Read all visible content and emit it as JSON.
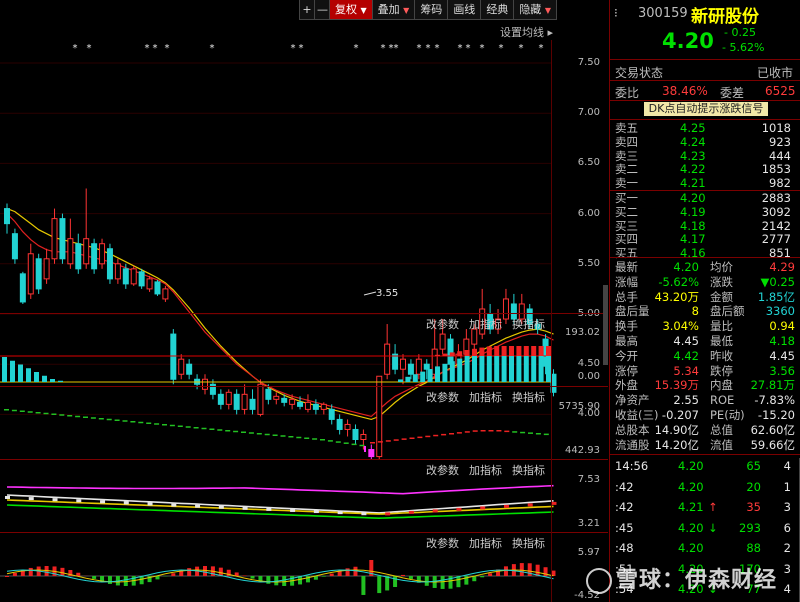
{
  "toolbar": {
    "plus": "+",
    "minus": "—",
    "fuquan": "复权",
    "diejia": "叠加",
    "chouma": "筹码",
    "huaxian": "画线",
    "jingdian": "经典",
    "tiaozhan": "隐藏",
    "dropdown_arrow": "▼"
  },
  "main_chart": {
    "setting_label": "设置均线",
    "low_marker": "3.55",
    "price_ticks": [
      "7.50",
      "7.00",
      "6.50",
      "6.00",
      "5.50",
      "5.00",
      "4.50",
      "4.00"
    ],
    "kline": [
      {
        "o": 6.05,
        "c": 5.9,
        "h": 6.1,
        "l": 5.8
      },
      {
        "o": 5.8,
        "c": 5.55,
        "h": 5.85,
        "l": 5.5
      },
      {
        "o": 5.4,
        "c": 5.12,
        "h": 5.42,
        "l": 5.1
      },
      {
        "o": 5.2,
        "c": 5.6,
        "h": 5.7,
        "l": 5.15
      },
      {
        "o": 5.55,
        "c": 5.25,
        "h": 5.6,
        "l": 5.2
      },
      {
        "o": 5.35,
        "c": 5.55,
        "h": 5.65,
        "l": 5.3
      },
      {
        "o": 5.55,
        "c": 5.95,
        "h": 6.05,
        "l": 5.5
      },
      {
        "o": 5.95,
        "c": 5.55,
        "h": 6.0,
        "l": 5.5
      },
      {
        "o": 5.5,
        "c": 5.75,
        "h": 5.95,
        "l": 5.45
      },
      {
        "o": 5.7,
        "c": 5.45,
        "h": 5.8,
        "l": 5.4
      },
      {
        "o": 5.5,
        "c": 5.75,
        "h": 6.25,
        "l": 5.45
      },
      {
        "o": 5.7,
        "c": 5.45,
        "h": 5.75,
        "l": 5.4
      },
      {
        "o": 5.5,
        "c": 5.7,
        "h": 5.75,
        "l": 5.45
      },
      {
        "o": 5.65,
        "c": 5.35,
        "h": 5.7,
        "l": 5.3
      },
      {
        "o": 5.35,
        "c": 5.5,
        "h": 5.55,
        "l": 5.3
      },
      {
        "o": 5.45,
        "c": 5.3,
        "h": 5.5,
        "l": 5.25
      },
      {
        "o": 5.3,
        "c": 5.45,
        "h": 5.48,
        "l": 5.28
      },
      {
        "o": 5.42,
        "c": 5.28,
        "h": 5.45,
        "l": 5.25
      },
      {
        "o": 5.25,
        "c": 5.35,
        "h": 5.38,
        "l": 5.22
      },
      {
        "o": 5.32,
        "c": 5.2,
        "h": 5.34,
        "l": 5.18
      },
      {
        "o": 5.15,
        "c": 5.25,
        "h": 5.28,
        "l": 5.12
      },
      {
        "o": 4.8,
        "c": 4.35,
        "h": 4.85,
        "l": 4.3
      },
      {
        "o": 4.4,
        "c": 4.55,
        "h": 4.6,
        "l": 4.35
      },
      {
        "o": 4.5,
        "c": 4.4,
        "h": 4.55,
        "l": 4.35
      },
      {
        "o": 4.35,
        "c": 4.3,
        "h": 4.4,
        "l": 4.25
      },
      {
        "o": 4.25,
        "c": 4.35,
        "h": 4.4,
        "l": 4.2
      },
      {
        "o": 4.3,
        "c": 4.2,
        "h": 4.35,
        "l": 4.15
      },
      {
        "o": 4.2,
        "c": 4.1,
        "h": 4.25,
        "l": 4.05
      },
      {
        "o": 4.1,
        "c": 4.22,
        "h": 4.25,
        "l": 4.05
      },
      {
        "o": 4.2,
        "c": 4.05,
        "h": 4.25,
        "l": 4.0
      },
      {
        "o": 4.05,
        "c": 4.2,
        "h": 4.3,
        "l": 4.0
      },
      {
        "o": 4.15,
        "c": 4.05,
        "h": 4.25,
        "l": 4.0
      },
      {
        "o": 4.0,
        "c": 4.3,
        "h": 4.35,
        "l": 3.98
      },
      {
        "o": 4.25,
        "c": 4.15,
        "h": 4.3,
        "l": 4.1
      },
      {
        "o": 4.15,
        "c": 4.18,
        "h": 4.22,
        "l": 4.1
      },
      {
        "o": 4.16,
        "c": 4.12,
        "h": 4.2,
        "l": 4.08
      },
      {
        "o": 4.1,
        "c": 4.15,
        "h": 4.2,
        "l": 4.05
      },
      {
        "o": 4.12,
        "c": 4.08,
        "h": 4.18,
        "l": 4.05
      },
      {
        "o": 4.05,
        "c": 4.12,
        "h": 4.2,
        "l": 4.02
      },
      {
        "o": 4.1,
        "c": 4.05,
        "h": 4.15,
        "l": 4.0
      },
      {
        "o": 4.05,
        "c": 4.1,
        "h": 4.12,
        "l": 4.0
      },
      {
        "o": 4.05,
        "c": 3.95,
        "h": 4.1,
        "l": 3.9
      },
      {
        "o": 3.95,
        "c": 3.85,
        "h": 4.0,
        "l": 3.8
      },
      {
        "o": 3.85,
        "c": 3.9,
        "h": 3.95,
        "l": 3.78
      },
      {
        "o": 3.85,
        "c": 3.75,
        "h": 3.9,
        "l": 3.7
      },
      {
        "o": 3.75,
        "c": 3.8,
        "h": 3.85,
        "l": 3.65
      },
      {
        "o": 3.65,
        "c": 3.58,
        "h": 3.7,
        "l": 3.55
      },
      {
        "o": 3.58,
        "c": 4.38,
        "h": 4.38,
        "l": 3.55
      },
      {
        "o": 4.4,
        "c": 4.7,
        "h": 4.9,
        "l": 4.35
      },
      {
        "o": 4.6,
        "c": 4.45,
        "h": 4.7,
        "l": 4.4
      },
      {
        "o": 4.45,
        "c": 4.55,
        "h": 4.6,
        "l": 4.3
      },
      {
        "o": 4.5,
        "c": 4.4,
        "h": 4.55,
        "l": 4.35
      },
      {
        "o": 4.4,
        "c": 4.55,
        "h": 4.6,
        "l": 4.35
      },
      {
        "o": 4.5,
        "c": 4.45,
        "h": 4.55,
        "l": 4.35
      },
      {
        "o": 4.4,
        "c": 4.65,
        "h": 4.95,
        "l": 4.35
      },
      {
        "o": 4.65,
        "c": 4.8,
        "h": 4.95,
        "l": 4.6
      },
      {
        "o": 4.75,
        "c": 4.5,
        "h": 4.8,
        "l": 4.45
      },
      {
        "o": 4.5,
        "c": 4.6,
        "h": 4.7,
        "l": 4.45
      },
      {
        "o": 4.6,
        "c": 4.75,
        "h": 4.85,
        "l": 4.55
      },
      {
        "o": 4.7,
        "c": 4.85,
        "h": 4.9,
        "l": 4.65
      },
      {
        "o": 4.8,
        "c": 5.05,
        "h": 5.25,
        "l": 4.75
      },
      {
        "o": 5.0,
        "c": 4.85,
        "h": 5.1,
        "l": 4.8
      },
      {
        "o": 4.85,
        "c": 4.95,
        "h": 5.05,
        "l": 4.8
      },
      {
        "o": 4.95,
        "c": 5.15,
        "h": 5.25,
        "l": 4.9
      },
      {
        "o": 5.1,
        "c": 4.95,
        "h": 5.2,
        "l": 4.9
      },
      {
        "o": 4.95,
        "c": 5.1,
        "h": 5.2,
        "l": 4.9
      },
      {
        "o": 5.05,
        "c": 4.9,
        "h": 5.1,
        "l": 4.85
      },
      {
        "o": 4.9,
        "c": 4.85,
        "h": 4.95,
        "l": 4.8
      },
      {
        "o": 4.75,
        "c": 4.48,
        "h": 4.8,
        "l": 4.4
      },
      {
        "o": 4.4,
        "c": 4.22,
        "h": 4.45,
        "l": 4.18
      }
    ],
    "ma_red": [
      6.0,
      5.92,
      5.82,
      5.74,
      5.68,
      5.64,
      5.62,
      5.62,
      5.62,
      5.6,
      5.58,
      5.56,
      5.54,
      5.52,
      5.49,
      5.46,
      5.43,
      5.4,
      5.37,
      5.34,
      5.3,
      5.22,
      5.12,
      5.02,
      4.92,
      4.82,
      4.74,
      4.66,
      4.58,
      4.5,
      4.44,
      4.38,
      4.32,
      4.28,
      4.24,
      4.21,
      4.18,
      4.16,
      4.14,
      4.12,
      4.1,
      4.08,
      4.06,
      4.04,
      4.02,
      4.0,
      3.98,
      4.05,
      4.12,
      4.18,
      4.22,
      4.26,
      4.3,
      4.33,
      4.38,
      4.42,
      4.45,
      4.48,
      4.51,
      4.55,
      4.6,
      4.64,
      4.68,
      4.72,
      4.75,
      4.78,
      4.8,
      4.8,
      4.78,
      4.74
    ],
    "ma_yellow": [
      6.05,
      6.02,
      5.96,
      5.9,
      5.84,
      5.8,
      5.76,
      5.74,
      5.72,
      5.7,
      5.68,
      5.66,
      5.63,
      5.6,
      5.56,
      5.52,
      5.48,
      5.44,
      5.4,
      5.36,
      5.31,
      5.24,
      5.15,
      5.06,
      4.96,
      4.86,
      4.77,
      4.68,
      4.6,
      4.52,
      4.45,
      4.38,
      4.32,
      4.27,
      4.23,
      4.19,
      4.16,
      4.13,
      4.11,
      4.09,
      4.07,
      4.05,
      4.03,
      4.01,
      3.99,
      3.97,
      3.95,
      3.98,
      4.05,
      4.12,
      4.18,
      4.23,
      4.28,
      4.32,
      4.37,
      4.42,
      4.46,
      4.5,
      4.54,
      4.59,
      4.64,
      4.68,
      4.72,
      4.76,
      4.79,
      4.82,
      4.84,
      4.85,
      4.83,
      4.8
    ]
  },
  "sub_labels": {
    "gaicanshu": "改参数",
    "jiazhibiao": "加指标",
    "huanzhibiao": "换指标",
    "sub1_max": "193.02",
    "sub1_min": "0.00",
    "sub2_max": "5735.90",
    "sub2_min": "442.93",
    "sub3_max": "7.53",
    "sub3_min": "3.21",
    "sub4_max": "5.97",
    "sub4_min": "-4.52"
  },
  "quote": {
    "code": "300159",
    "name": "新研股份",
    "price": "4.20",
    "change": "- 0.25",
    "change_pct": "- 5.62%",
    "trade_status_label": "交易状态",
    "trade_status": "已收市",
    "weibi_label": "委比",
    "weibi": "38.46%",
    "weicha_label": "委差",
    "weicha": "6525",
    "dk_signal": "DK点自动提示涨跌信号",
    "sell": [
      {
        "label": "卖五",
        "price": "4.25",
        "vol": "1018"
      },
      {
        "label": "卖四",
        "price": "4.24",
        "vol": "923"
      },
      {
        "label": "卖三",
        "price": "4.23",
        "vol": "444"
      },
      {
        "label": "卖二",
        "price": "4.22",
        "vol": "1853"
      },
      {
        "label": "卖一",
        "price": "4.21",
        "vol": "982"
      }
    ],
    "buy": [
      {
        "label": "买一",
        "price": "4.20",
        "vol": "2883"
      },
      {
        "label": "买二",
        "price": "4.19",
        "vol": "3092"
      },
      {
        "label": "买三",
        "price": "4.18",
        "vol": "2142"
      },
      {
        "label": "买四",
        "price": "4.17",
        "vol": "2777"
      },
      {
        "label": "买五",
        "price": "4.16",
        "vol": "851"
      }
    ],
    "stats": [
      {
        "l1": "最新",
        "v1": "4.20",
        "c1": "grn",
        "l2": "均价",
        "v2": "4.29",
        "c2": "red"
      },
      {
        "l1": "涨幅",
        "v1": "-5.62%",
        "c1": "grn",
        "l2": "涨跌",
        "v2": "▼0.25",
        "c2": "grn"
      },
      {
        "l1": "总手",
        "v1": "43.20万",
        "c1": "yel",
        "l2": "金额",
        "v2": "1.85亿",
        "c2": "cy"
      },
      {
        "l1": "盘后量",
        "v1": "8",
        "c1": "yel",
        "l2": "盘后额",
        "v2": "3360",
        "c2": "cy"
      },
      {
        "l1": "换手",
        "v1": "3.04%",
        "c1": "yel",
        "l2": "量比",
        "v2": "0.94",
        "c2": "yel"
      },
      {
        "l1": "最高",
        "v1": "4.45",
        "c1": "wht",
        "l2": "最低",
        "v2": "4.18",
        "c2": "grn"
      },
      {
        "l1": "今开",
        "v1": "4.42",
        "c1": "grn",
        "l2": "昨收",
        "v2": "4.45",
        "c2": "wht"
      },
      {
        "l1": "涨停",
        "v1": "5.34",
        "c1": "red",
        "l2": "跌停",
        "v2": "3.56",
        "c2": "grn"
      },
      {
        "l1": "外盘",
        "v1": "15.39万",
        "c1": "red",
        "l2": "内盘",
        "v2": "27.81万",
        "c2": "grn"
      },
      {
        "l1": "净资产",
        "v1": "2.55",
        "c1": "wht",
        "l2": "ROE",
        "v2": "-7.83%",
        "c2": "wht"
      },
      {
        "l1": "收益(三)",
        "v1": "-0.207",
        "c1": "wht",
        "l2": "PE(动)",
        "v2": "-15.20",
        "c2": "wht"
      },
      {
        "l1": "总股本",
        "v1": "14.90亿",
        "c1": "wht",
        "l2": "总值",
        "v2": "62.60亿",
        "c2": "wht"
      },
      {
        "l1": "流通股",
        "v1": "14.20亿",
        "c1": "wht",
        "l2": "流值",
        "v2": "59.66亿",
        "c2": "wht"
      }
    ],
    "ticks": [
      {
        "time": "14:56",
        "price": "4.20",
        "vol": "65",
        "n": "4",
        "dir": ""
      },
      {
        "time": ":42",
        "price": "4.20",
        "vol": "20",
        "n": "1",
        "dir": ""
      },
      {
        "time": ":42",
        "price": "4.21",
        "vol": "35",
        "n": "3",
        "dir": "↑"
      },
      {
        "time": ":45",
        "price": "4.20",
        "vol": "293",
        "n": "6",
        "dir": "↓"
      },
      {
        "time": ":48",
        "price": "4.20",
        "vol": "88",
        "n": "2",
        "dir": ""
      },
      {
        "time": ":51",
        "price": "4.20",
        "vol": "170",
        "n": "3",
        "dir": ""
      },
      {
        "time": ":54",
        "price": "4.20",
        "vol": "77",
        "n": "4",
        "dir": "↓"
      }
    ]
  },
  "watermark": "雪球：伊森财经",
  "colors": {
    "up": "#ff3333",
    "down": "#22d3d3",
    "accent": "#b40000",
    "ma_yellow": "#e6c800",
    "ma_magenta": "#ff33ff"
  }
}
